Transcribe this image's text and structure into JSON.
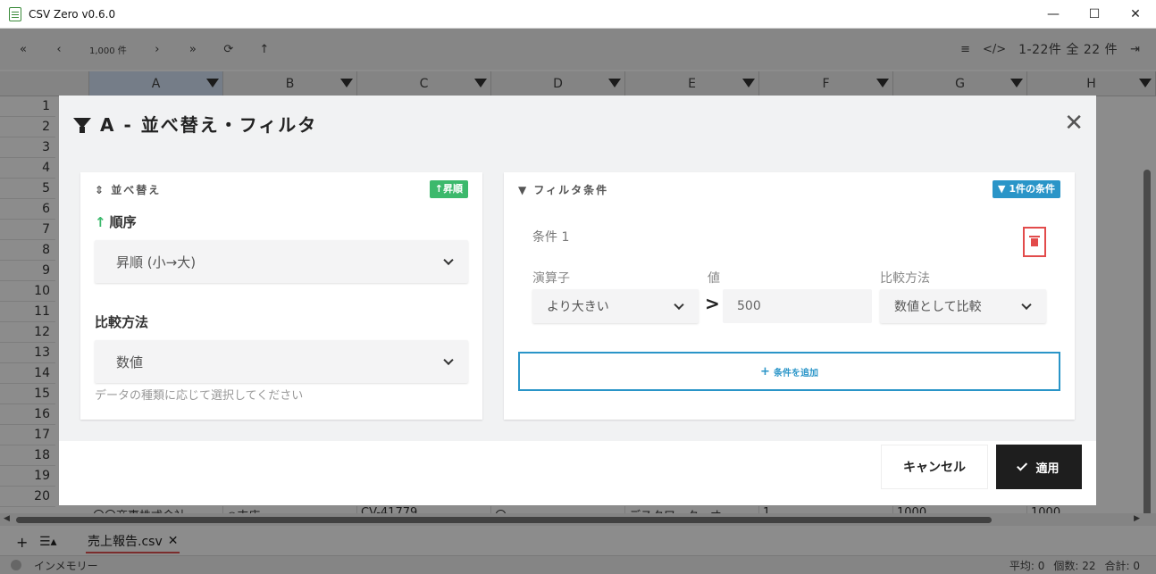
{
  "window": {
    "title": "CSV Zero v0.6.0",
    "controls": {
      "minimize": "—",
      "maximize": "☐",
      "close": "✕"
    }
  },
  "toolbar": {
    "first": "«",
    "prev": "‹",
    "page_size": "1,000 件",
    "next": "›",
    "last": "»",
    "refresh": "⟳",
    "top": "↑",
    "menu": "≡",
    "code": "</>",
    "range_count": "1-22件 全 22 件",
    "export": "⇥"
  },
  "grid": {
    "columns": [
      "A",
      "B",
      "C",
      "D",
      "E",
      "F",
      "G",
      "H"
    ],
    "rows": [
      "1",
      "2",
      "3",
      "4",
      "5",
      "6",
      "7",
      "8",
      "9",
      "10",
      "11",
      "12",
      "13",
      "14",
      "15",
      "16",
      "17",
      "18",
      "19",
      "20"
    ],
    "peek_row": [
      "〇〇商事株式会社",
      "○支店",
      "CV-41779",
      "〇",
      "デスクワーク・オ",
      "1",
      "1000",
      "1000"
    ]
  },
  "tabs": {
    "add": "+",
    "menu": "☰▴",
    "file_name": "売上報告.csv",
    "file_close": "✕"
  },
  "status": {
    "mode": "インメモリー",
    "avg": "平均: 0",
    "count": "個数: 22",
    "sum": "合計: 0"
  },
  "dialog": {
    "title": "A - 並べ替え・フィルタ",
    "close": "✕",
    "sort": {
      "panel_title": "並べ替え",
      "badge": "↑昇順",
      "order_label": "順序",
      "order_value": "昇順 (小→大)",
      "compare_label": "比較方法",
      "compare_value": "数値",
      "hint": "データの種類に応じて選択してください"
    },
    "filter": {
      "panel_title": "フィルタ条件",
      "badge": "1件の条件",
      "condition_label": "条件 1",
      "operator_label": "演算子",
      "value_label": "値",
      "compare_label": "比較方法",
      "operator_value": "より大きい",
      "operator_symbol": ">",
      "value": "500",
      "compare_value": "数値として比較",
      "add_condition": "条件を追加"
    },
    "footer": {
      "cancel": "キャンセル",
      "apply": "適用"
    }
  },
  "colors": {
    "sort_badge": "#3cb96c",
    "filter_badge": "#2a95c8",
    "delete": "#e24b4b",
    "apply_button": "#1e1e1e"
  }
}
